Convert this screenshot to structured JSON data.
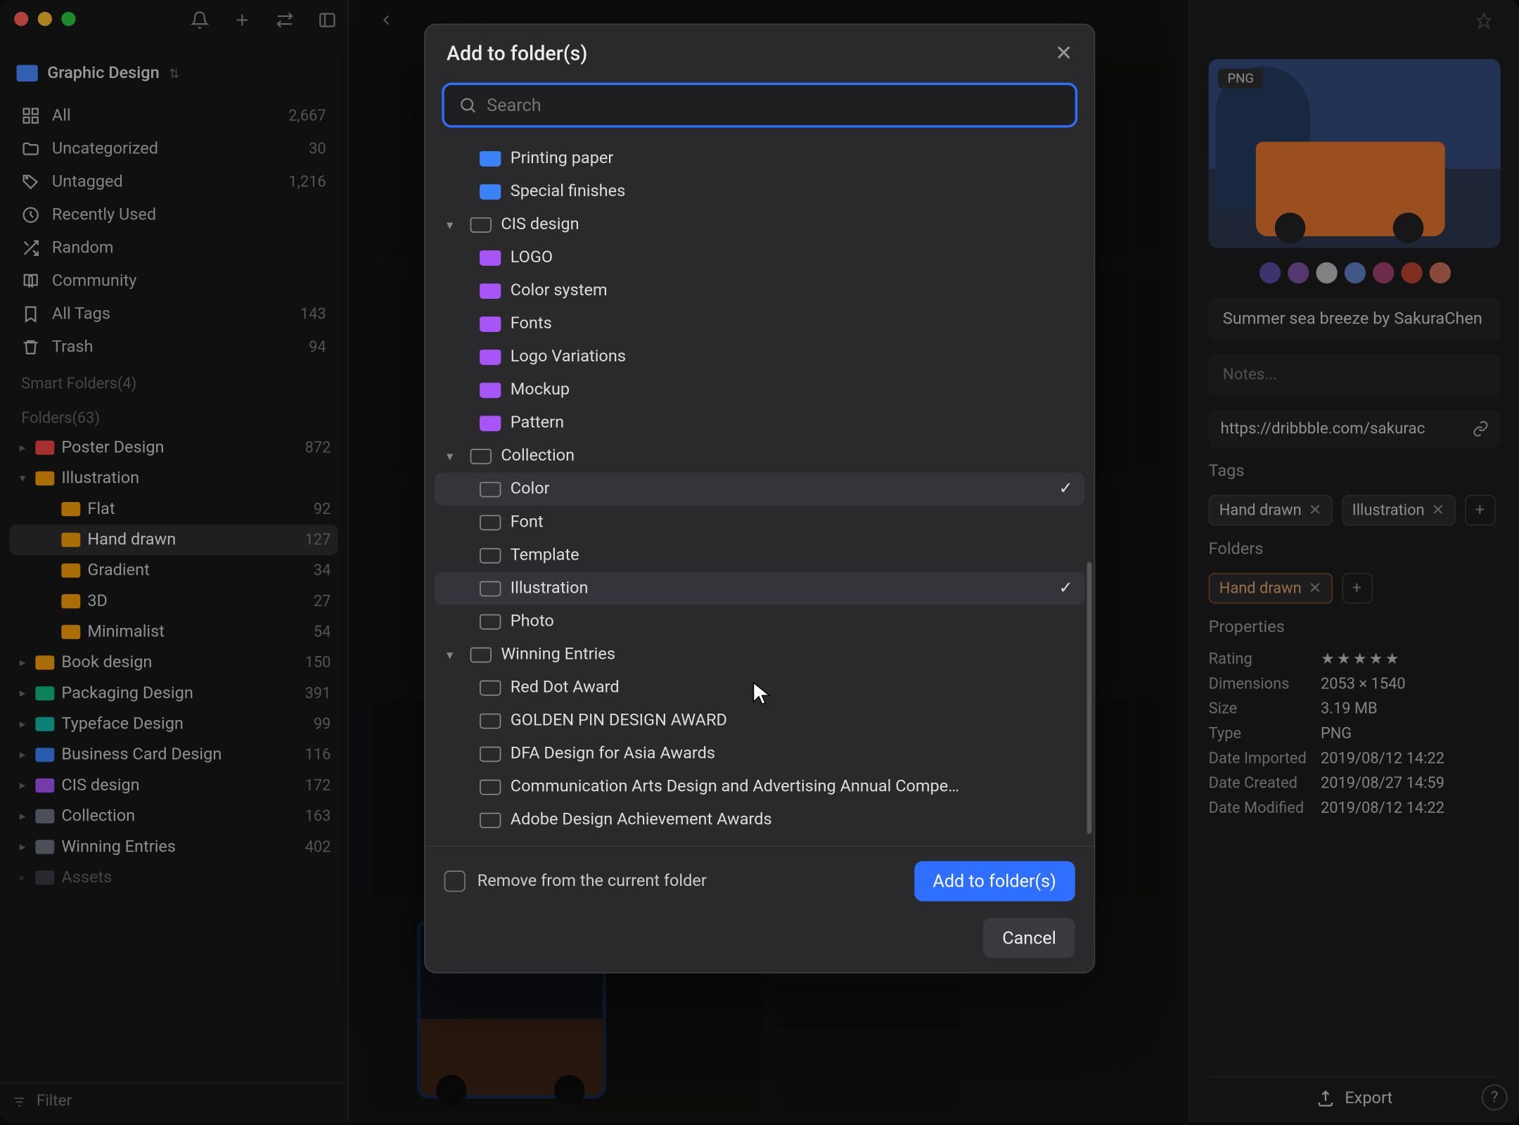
{
  "library": {
    "name": "Graphic Design"
  },
  "nav": [
    {
      "icon": "grid",
      "label": "All",
      "count": "2,667"
    },
    {
      "icon": "folder",
      "label": "Uncategorized",
      "count": "30"
    },
    {
      "icon": "tag",
      "label": "Untagged",
      "count": "1,216"
    },
    {
      "icon": "clock",
      "label": "Recently Used",
      "count": ""
    },
    {
      "icon": "shuffle",
      "label": "Random",
      "count": ""
    },
    {
      "icon": "book",
      "label": "Community",
      "count": ""
    },
    {
      "icon": "bookmark",
      "label": "All Tags",
      "count": "143"
    },
    {
      "icon": "trash",
      "label": "Trash",
      "count": "94"
    }
  ],
  "sections": {
    "smart": "Smart Folders(4)",
    "folders": "Folders(63)"
  },
  "folders": [
    {
      "label": "Poster Design",
      "color": "c-red",
      "count": "872",
      "caret": true
    },
    {
      "label": "Illustration",
      "color": "c-orange",
      "count": "",
      "caret": true,
      "expanded": true,
      "children": [
        {
          "label": "Flat",
          "count": "92"
        },
        {
          "label": "Hand drawn",
          "count": "127",
          "selected": true
        },
        {
          "label": "Gradient",
          "count": "34"
        },
        {
          "label": "3D",
          "count": "27"
        },
        {
          "label": "Minimalist",
          "count": "54"
        }
      ]
    },
    {
      "label": "Book design",
      "color": "c-orange",
      "count": "150",
      "caret": true
    },
    {
      "label": "Packaging Design",
      "color": "c-green",
      "count": "391",
      "caret": true
    },
    {
      "label": "Typeface Design",
      "color": "c-teal",
      "count": "99",
      "caret": true
    },
    {
      "label": "Business Card Design",
      "color": "c-blue",
      "count": "116",
      "caret": true
    },
    {
      "label": "CIS design",
      "color": "c-purple",
      "count": "172",
      "caret": true
    },
    {
      "label": "Collection",
      "color": "c-gray",
      "count": "163",
      "caret": true
    },
    {
      "label": "Winning Entries",
      "color": "c-gray",
      "count": "402",
      "caret": true
    },
    {
      "label": "Assets",
      "color": "c-gray",
      "count": "",
      "caret": true,
      "cut": true
    }
  ],
  "filter_placeholder": "Filter",
  "modal": {
    "title": "Add to folder(s)",
    "search_placeholder": "Search",
    "rows": [
      {
        "depth": 1,
        "label": "Printing paper",
        "color": "c-blue"
      },
      {
        "depth": 1,
        "label": "Special finishes",
        "color": "c-blue"
      },
      {
        "depth": 0,
        "label": "CIS design",
        "color": "c-purple",
        "caret": "▾",
        "outline": true
      },
      {
        "depth": 1,
        "label": "LOGO",
        "color": "c-purple"
      },
      {
        "depth": 1,
        "label": "Color system",
        "color": "c-purple"
      },
      {
        "depth": 1,
        "label": "Fonts",
        "color": "c-purple"
      },
      {
        "depth": 1,
        "label": "Logo Variations",
        "color": "c-purple"
      },
      {
        "depth": 1,
        "label": "Mockup",
        "color": "c-purple"
      },
      {
        "depth": 1,
        "label": "Pattern",
        "color": "c-purple"
      },
      {
        "depth": 0,
        "label": "Collection",
        "outline": true,
        "caret": "▾"
      },
      {
        "depth": 1,
        "label": "Color",
        "outline": true,
        "checked": true
      },
      {
        "depth": 1,
        "label": "Font",
        "outline": true
      },
      {
        "depth": 1,
        "label": "Template",
        "outline": true
      },
      {
        "depth": 1,
        "label": "Illustration",
        "outline": true,
        "checked": true,
        "hover": true
      },
      {
        "depth": 1,
        "label": "Photo",
        "outline": true
      },
      {
        "depth": 0,
        "label": "Winning Entries",
        "outline": true,
        "caret": "▾"
      },
      {
        "depth": 1,
        "label": "Red Dot Award",
        "outline": true
      },
      {
        "depth": 1,
        "label": "GOLDEN PIN DESIGN AWARD",
        "outline": true
      },
      {
        "depth": 1,
        "label": "DFA Design for Asia Awards",
        "outline": true
      },
      {
        "depth": 1,
        "label": "Communication Arts Design and Advertising Annual Compe…",
        "outline": true
      },
      {
        "depth": 1,
        "label": "Adobe Design Achievement Awards",
        "outline": true
      }
    ],
    "remove_label": "Remove from the current folder",
    "primary": "Add to folder(s)",
    "secondary": "Cancel"
  },
  "inspector": {
    "badge": "PNG",
    "swatches": [
      "#5b4a9e",
      "#7a4fa0",
      "#b9b9bd",
      "#5d7bbd",
      "#9c3f6e",
      "#b5412f",
      "#c46a55"
    ],
    "title": "Summer sea breeze by SakuraChen",
    "notes_placeholder": "Notes...",
    "url": "https://dribbble.com/sakurac",
    "tags_label": "Tags",
    "tags": [
      "Hand drawn",
      "Illustration"
    ],
    "folders_label": "Folders",
    "folder_chips": [
      "Hand drawn"
    ],
    "properties_label": "Properties",
    "props": [
      {
        "k": "Rating",
        "v": "★★★★★",
        "stars": true
      },
      {
        "k": "Dimensions",
        "v": "2053 × 1540"
      },
      {
        "k": "Size",
        "v": "3.19 MB"
      },
      {
        "k": "Type",
        "v": "PNG"
      },
      {
        "k": "Date Imported",
        "v": "2019/08/12 14:22"
      },
      {
        "k": "Date Created",
        "v": "2019/08/27 14:59"
      },
      {
        "k": "Date Modified",
        "v": "2019/08/12 14:22"
      }
    ],
    "export": "Export"
  }
}
